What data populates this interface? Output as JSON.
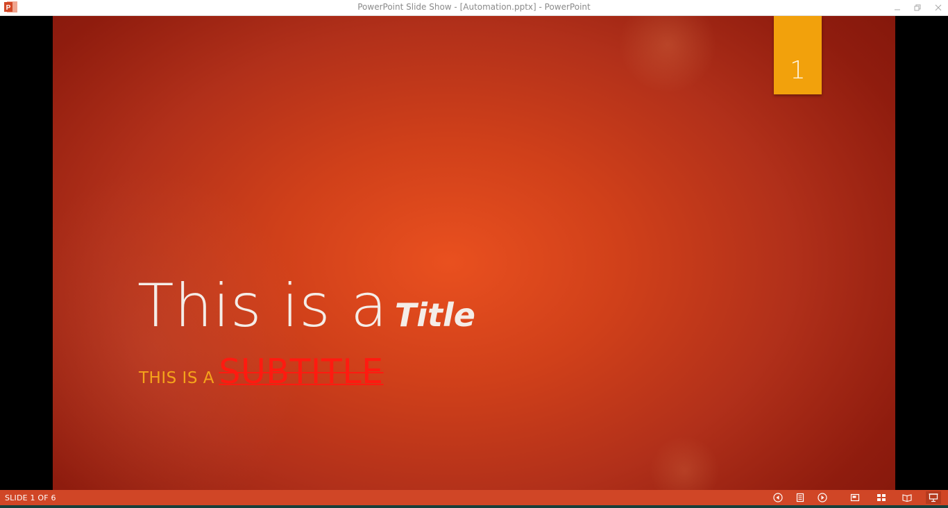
{
  "window": {
    "title": "PowerPoint Slide Show - [Automation.pptx] - PowerPoint",
    "app_icon": "powerpoint-icon",
    "controls": [
      "minimize-icon",
      "restore-icon",
      "close-icon"
    ]
  },
  "slide": {
    "number": "1",
    "title_main": "This is a",
    "title_emphasis": "Title",
    "subtitle_lead": "THIS IS A",
    "subtitle_strike": "SUBTITLE",
    "colors": {
      "background_center": "#e9501f",
      "background_edge": "#7e150a",
      "number_tag": "#f2a10c",
      "title": "#f4ede8",
      "subtitle_lead": "#f5a41b",
      "subtitle_strike": "#ff1a10"
    }
  },
  "status": {
    "slide_indicator": "SLIDE 1 OF 6",
    "nav_buttons": [
      "previous-slide-icon",
      "slide-list-icon",
      "next-slide-icon"
    ],
    "view_buttons": [
      "normal-view-icon",
      "slide-sorter-icon",
      "reading-view-icon",
      "slide-show-icon"
    ],
    "bar_color": "#d04626"
  }
}
